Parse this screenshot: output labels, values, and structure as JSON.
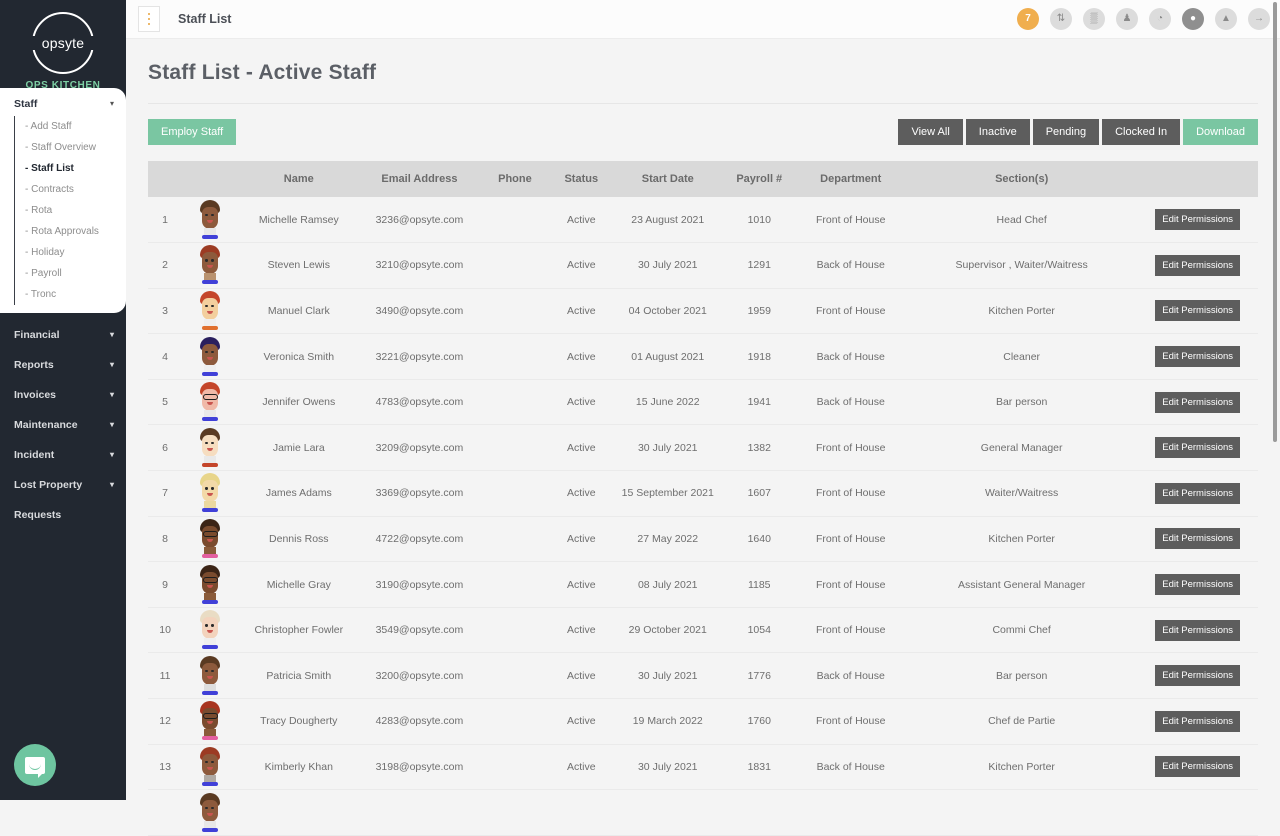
{
  "brand": {
    "logo_text": "opsyte",
    "subtitle": "OPS KITCHEN",
    "accent": "#7ecfa4"
  },
  "sidebar": {
    "staff_group": {
      "label": "Staff",
      "items": [
        {
          "label": "- Add Staff",
          "active": false
        },
        {
          "label": "- Staff Overview",
          "active": false
        },
        {
          "label": "- Staff List",
          "active": true
        },
        {
          "label": "- Contracts",
          "active": false
        },
        {
          "label": "- Rota",
          "active": false
        },
        {
          "label": "- Rota Approvals",
          "active": false
        },
        {
          "label": "- Holiday",
          "active": false
        },
        {
          "label": "- Payroll",
          "active": false
        },
        {
          "label": "- Tronc",
          "active": false
        }
      ]
    },
    "nav": [
      {
        "label": "Financial",
        "chevron": true
      },
      {
        "label": "Reports",
        "chevron": true
      },
      {
        "label": "Invoices",
        "chevron": true
      },
      {
        "label": "Maintenance",
        "chevron": true
      },
      {
        "label": "Incident",
        "chevron": true
      },
      {
        "label": "Lost Property",
        "chevron": true
      },
      {
        "label": "Requests",
        "chevron": false
      }
    ]
  },
  "topbar": {
    "menu_icon": "kebab-menu-icon",
    "title": "Staff List",
    "icons": [
      {
        "name": "notification-badge",
        "glyph": "7",
        "style": "badge"
      },
      {
        "name": "sort-updown-icon",
        "glyph": "⇅",
        "style": "light"
      },
      {
        "name": "grid-icon",
        "glyph": "▒",
        "style": "light"
      },
      {
        "name": "people-group-icon",
        "glyph": "♟",
        "style": "light"
      },
      {
        "name": "clock-icon",
        "glyph": "◔",
        "style": "light"
      },
      {
        "name": "globe-icon",
        "glyph": "●",
        "style": "dark"
      },
      {
        "name": "user-icon",
        "glyph": "▲",
        "style": "light"
      },
      {
        "name": "logout-icon",
        "glyph": "→",
        "style": "light"
      }
    ]
  },
  "page": {
    "title": "Staff List - Active Staff",
    "employ_button": "Employ Staff",
    "filters": [
      {
        "label": "View All",
        "style": "gray"
      },
      {
        "label": "Inactive",
        "style": "gray"
      },
      {
        "label": "Pending",
        "style": "gray"
      },
      {
        "label": "Clocked In",
        "style": "gray"
      },
      {
        "label": "Download",
        "style": "green"
      }
    ]
  },
  "table": {
    "columns": [
      "",
      "",
      "Name",
      "Email Address",
      "Phone",
      "Status",
      "Start Date",
      "Payroll #",
      "Department",
      "Section(s)",
      ""
    ],
    "action_label": "Edit Permissions",
    "rows": [
      {
        "idx": "1",
        "name": "Michelle Ramsey",
        "email": "3236@opsyte.com",
        "phone": "",
        "status": "Active",
        "start": "23 August 2021",
        "payroll": "1010",
        "dept": "Front of House",
        "section": "Head Chef",
        "avatar": {
          "hair": "#5a3a22",
          "skin": "#8d5a3c",
          "body": "#e7e7e7",
          "shoe": "#4040d8",
          "glasses": false
        }
      },
      {
        "idx": "2",
        "name": "Steven Lewis",
        "email": "3210@opsyte.com",
        "phone": "",
        "status": "Active",
        "start": "30 July 2021",
        "payroll": "1291",
        "dept": "Back of House",
        "section": "Supervisor , Waiter/Waitress",
        "avatar": {
          "hair": "#9c3b23",
          "skin": "#8d5a3c",
          "body": "#b9926f",
          "shoe": "#4040d8",
          "glasses": false
        }
      },
      {
        "idx": "3",
        "name": "Manuel Clark",
        "email": "3490@opsyte.com",
        "phone": "",
        "status": "Active",
        "start": "04 October 2021",
        "payroll": "1959",
        "dept": "Front of House",
        "section": "Kitchen Porter",
        "avatar": {
          "hair": "#c4452a",
          "skin": "#f3cf9e",
          "body": "#efefef",
          "shoe": "#e0702f",
          "glasses": false
        }
      },
      {
        "idx": "4",
        "name": "Veronica Smith",
        "email": "3221@opsyte.com",
        "phone": "",
        "status": "Active",
        "start": "01 August 2021",
        "payroll": "1918",
        "dept": "Back of House",
        "section": "Cleaner",
        "avatar": {
          "hair": "#2a1f5e",
          "skin": "#8d5a3c",
          "body": "#efefef",
          "shoe": "#4040d8",
          "glasses": false
        }
      },
      {
        "idx": "5",
        "name": "Jennifer Owens",
        "email": "4783@opsyte.com",
        "phone": "",
        "status": "Active",
        "start": "15 June 2022",
        "payroll": "1941",
        "dept": "Back of House",
        "section": "Bar person",
        "avatar": {
          "hair": "#c4452a",
          "skin": "#f0b9a8",
          "body": "#e9e9e9",
          "shoe": "#4040d8",
          "glasses": true
        }
      },
      {
        "idx": "6",
        "name": "Jamie Lara",
        "email": "3209@opsyte.com",
        "phone": "",
        "status": "Active",
        "start": "30 July 2021",
        "payroll": "1382",
        "dept": "Front of House",
        "section": "General Manager",
        "avatar": {
          "hair": "#5a3a22",
          "skin": "#f6ddc0",
          "body": "#e9e9e9",
          "shoe": "#c4452a",
          "glasses": false
        }
      },
      {
        "idx": "7",
        "name": "James Adams",
        "email": "3369@opsyte.com",
        "phone": "",
        "status": "Active",
        "start": "15 September 2021",
        "payroll": "1607",
        "dept": "Front of House",
        "section": "Waiter/Waitress",
        "avatar": {
          "hair": "#e8d58a",
          "skin": "#f3d9a8",
          "body": "#ecd9a0",
          "shoe": "#4040d8",
          "glasses": false
        }
      },
      {
        "idx": "8",
        "name": "Dennis Ross",
        "email": "4722@opsyte.com",
        "phone": "",
        "status": "Active",
        "start": "27 May 2022",
        "payroll": "1640",
        "dept": "Front of House",
        "section": "Kitchen Porter",
        "avatar": {
          "hair": "#3b2416",
          "skin": "#7a4b2e",
          "body": "#8a5b3a",
          "shoe": "#e45fa0",
          "glasses": true
        }
      },
      {
        "idx": "9",
        "name": "Michelle Gray",
        "email": "3190@opsyte.com",
        "phone": "",
        "status": "Active",
        "start": "08 July 2021",
        "payroll": "1185",
        "dept": "Front of House",
        "section": "Assistant General Manager",
        "avatar": {
          "hair": "#3b2416",
          "skin": "#7a4b2e",
          "body": "#8a5b3a",
          "shoe": "#4040d8",
          "glasses": true
        }
      },
      {
        "idx": "10",
        "name": "Christopher Fowler",
        "email": "3549@opsyte.com",
        "phone": "",
        "status": "Active",
        "start": "29 October 2021",
        "payroll": "1054",
        "dept": "Front of House",
        "section": "Commi Chef",
        "avatar": {
          "hair": "#e9dcc4",
          "skin": "#f3d3bd",
          "body": "#efefef",
          "shoe": "#4040d8",
          "glasses": false
        }
      },
      {
        "idx": "11",
        "name": "Patricia Smith",
        "email": "3200@opsyte.com",
        "phone": "",
        "status": "Active",
        "start": "30 July 2021",
        "payroll": "1776",
        "dept": "Back of House",
        "section": "Bar person",
        "avatar": {
          "hair": "#5a3a22",
          "skin": "#8d5a3c",
          "body": "#dedede",
          "shoe": "#4040d8",
          "glasses": false
        }
      },
      {
        "idx": "12",
        "name": "Tracy Dougherty",
        "email": "4283@opsyte.com",
        "phone": "",
        "status": "Active",
        "start": "19 March 2022",
        "payroll": "1760",
        "dept": "Front of House",
        "section": "Chef de Partie",
        "avatar": {
          "hair": "#a8341f",
          "skin": "#7a4b2e",
          "body": "#8a5b3a",
          "shoe": "#e45fa0",
          "glasses": true
        }
      },
      {
        "idx": "13",
        "name": "Kimberly Khan",
        "email": "3198@opsyte.com",
        "phone": "",
        "status": "Active",
        "start": "30 July 2021",
        "payroll": "1831",
        "dept": "Back of House",
        "section": "Kitchen Porter",
        "avatar": {
          "hair": "#9c3b23",
          "skin": "#8d5a3c",
          "body": "#b0aaa4",
          "shoe": "#4040d8",
          "glasses": false
        }
      },
      {
        "idx": "",
        "name": "",
        "email": "",
        "phone": "",
        "status": "",
        "start": "",
        "payroll": "",
        "dept": "",
        "section": "",
        "partial": true,
        "avatar": {
          "hair": "#5a3a22",
          "skin": "#8d5a3c",
          "body": "#e7e7e7",
          "shoe": "#4040d8",
          "glasses": false
        }
      }
    ]
  },
  "chat": {
    "icon": "chat-bubble-icon",
    "color": "#6ec5a0"
  }
}
